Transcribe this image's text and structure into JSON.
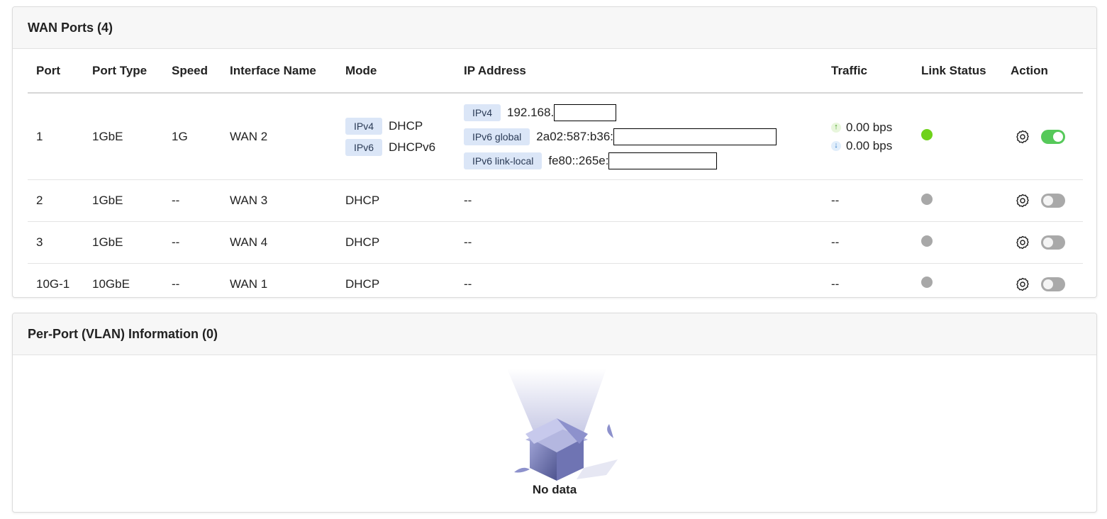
{
  "wan": {
    "title": "WAN Ports (4)",
    "columns": [
      "Port",
      "Port Type",
      "Speed",
      "Interface Name",
      "Mode",
      "IP Address",
      "Traffic",
      "Link Status",
      "Action"
    ],
    "rows": [
      {
        "port": "1",
        "port_type": "1GbE",
        "speed": "1G",
        "interface": "WAN 2",
        "modes": [
          {
            "tag": "IPv4",
            "value": "DHCP"
          },
          {
            "tag": "IPv6",
            "value": "DHCPv6"
          }
        ],
        "ips": [
          {
            "tag": "IPv4",
            "value": "192.168."
          },
          {
            "tag": "IPv6 global",
            "value": "2a02:587:b36:"
          },
          {
            "tag": "IPv6 link-local",
            "value": "fe80::265e:"
          }
        ],
        "traffic_up": "0.00 bps",
        "traffic_down": "0.00 bps",
        "link_status": "up",
        "enabled": true
      },
      {
        "port": "2",
        "port_type": "1GbE",
        "speed": "--",
        "interface": "WAN 3",
        "mode": "DHCP",
        "ip": "--",
        "traffic": "--",
        "link_status": "down",
        "enabled": false
      },
      {
        "port": "3",
        "port_type": "1GbE",
        "speed": "--",
        "interface": "WAN 4",
        "mode": "DHCP",
        "ip": "--",
        "traffic": "--",
        "link_status": "down",
        "enabled": false
      },
      {
        "port": "10G-1",
        "port_type": "10GbE",
        "speed": "--",
        "interface": "WAN 1",
        "mode": "DHCP",
        "ip": "--",
        "traffic": "--",
        "link_status": "down",
        "enabled": false
      }
    ]
  },
  "vlan": {
    "title": "Per-Port (VLAN) Information (0)",
    "empty_text": "No data"
  },
  "colors": {
    "link_up": "#6fd21a",
    "link_down": "#a8a8a8",
    "toggle_on": "#56c95a",
    "toggle_off": "#a9a9a9",
    "tag_bg": "#dbe6f7"
  },
  "icons": {
    "action_settings": "gear-icon",
    "traffic_up": "arrow-up-icon",
    "traffic_down": "arrow-down-icon",
    "empty": "empty-box-illustration"
  }
}
